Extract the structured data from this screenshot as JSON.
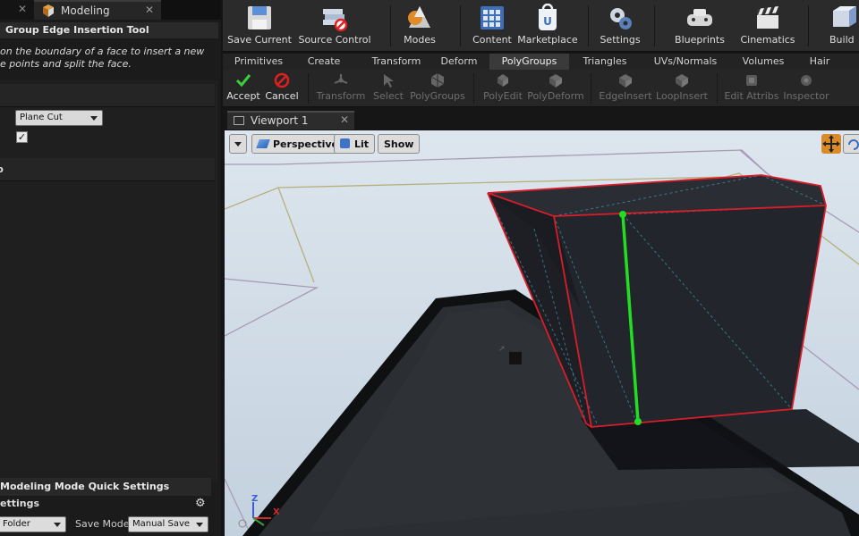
{
  "left_panel": {
    "tab_label": "Modeling",
    "tool_title": "Group Edge Insertion Tool",
    "description_lines": [
      "on the boundary of a face to insert a new",
      "e points and split the face."
    ],
    "insertion_mode_value": "Plane Cut",
    "checkbox_checked": "✓",
    "category2_label": "p",
    "quick_settings_title": "Modeling Mode Quick Settings",
    "settings_label": "ettings",
    "folder_value": "Folder",
    "save_mode_label": "Save Mode",
    "save_mode_value": "Manual Save"
  },
  "toolbar": {
    "buttons": [
      {
        "label": "Save Current",
        "icon": "save-icon"
      },
      {
        "label": "Source Control",
        "icon": "source-control-icon"
      },
      {
        "label": "Modes",
        "icon": "modes-icon"
      },
      {
        "label": "Content",
        "icon": "content-icon"
      },
      {
        "label": "Marketplace",
        "icon": "marketplace-icon"
      },
      {
        "label": "Settings",
        "icon": "settings-icon"
      },
      {
        "label": "Blueprints",
        "icon": "blueprints-icon"
      },
      {
        "label": "Cinematics",
        "icon": "cinematics-icon"
      },
      {
        "label": "Build",
        "icon": "build-icon"
      }
    ]
  },
  "mode_tabs": {
    "items": [
      "Primitives",
      "Create",
      "Transform",
      "Deform",
      "PolyGroups",
      "Triangles",
      "UVs/Normals",
      "Volumes",
      "Hair"
    ],
    "active": "PolyGroups"
  },
  "palette": {
    "accept": "Accept",
    "cancel": "Cancel",
    "tools": [
      "Transform",
      "Select",
      "PolyGroups",
      "PolyEdit",
      "PolyDeform",
      "EdgeInsert",
      "LoopInsert",
      "Edit Attribs",
      "Inspector"
    ]
  },
  "viewport": {
    "tab_label": "Viewport 1",
    "perspective_label": "Perspective",
    "lit_label": "Lit",
    "show_label": "Show",
    "axis_z": "Z",
    "axis_x": "X"
  },
  "colors": {
    "accent_active_tab": "#3a3a3a",
    "accept_green": "#3ccf3c",
    "cancel_red": "#e02020",
    "selection_edge": "#d81e2a",
    "inserted_edge": "#22dd22",
    "viewport_bg": "#c9d6e2"
  }
}
